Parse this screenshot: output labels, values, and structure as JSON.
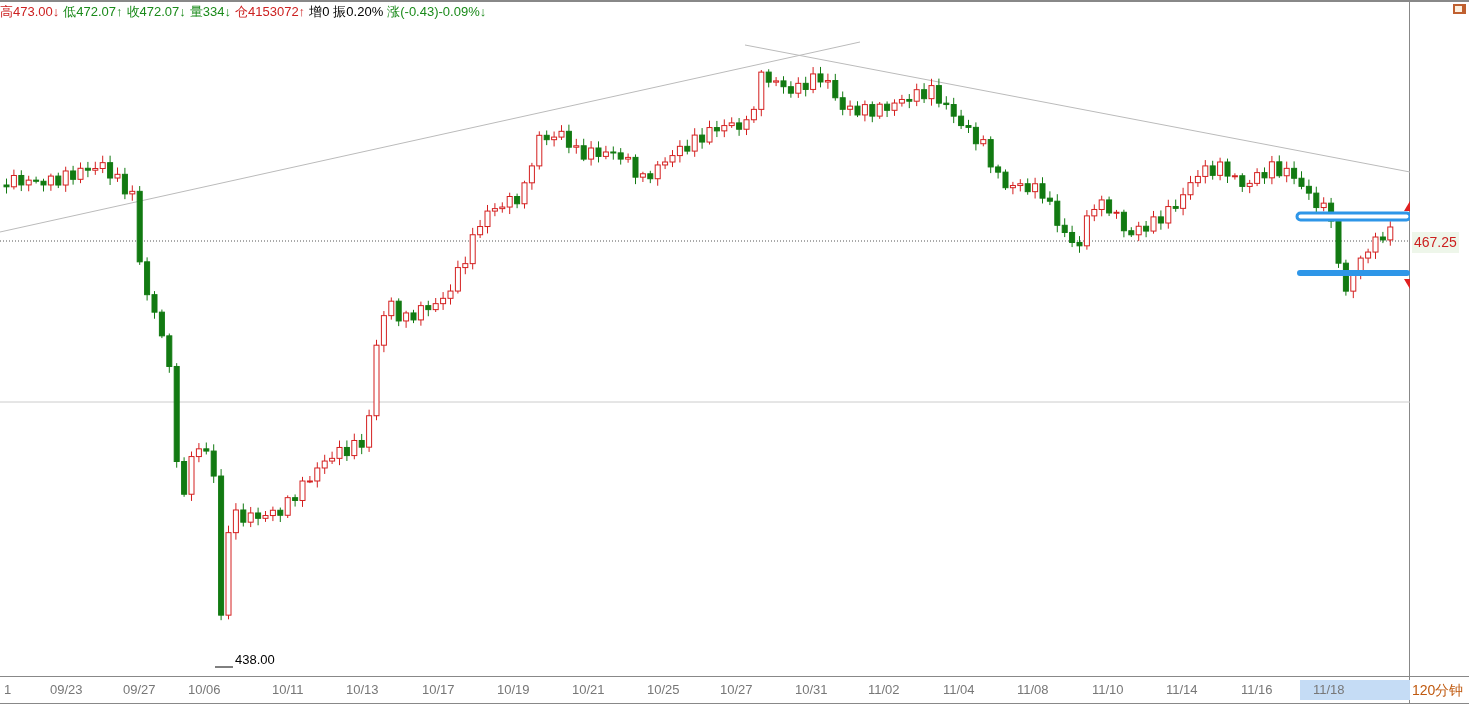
{
  "header": {
    "stats": [
      {
        "text": "高473.00↓",
        "color": "#cc2020"
      },
      {
        "text": "低472.07↑",
        "color": "#1a8a1a"
      },
      {
        "text": "收472.07↓",
        "color": "#1a8a1a"
      },
      {
        "text": "量334↓",
        "color": "#1a8a1a"
      },
      {
        "text": "仓4153072↑",
        "color": "#cc2020"
      },
      {
        "text": "增0",
        "color": "#000000"
      },
      {
        "text": "振0.20%",
        "color": "#000000"
      },
      {
        "text": "涨(-0.43)-0.09%↓",
        "color": "#1a8a1a"
      }
    ]
  },
  "chart": {
    "price_tag": "467.25",
    "low_label": "438.00"
  },
  "x_axis": {
    "labels": [
      {
        "text": "1",
        "selected": false
      },
      {
        "text": "09/23",
        "selected": false
      },
      {
        "text": "09/27",
        "selected": false
      },
      {
        "text": "10/06",
        "selected": false
      },
      {
        "text": "10/11",
        "selected": false
      },
      {
        "text": "10/13",
        "selected": false
      },
      {
        "text": "10/17",
        "selected": false
      },
      {
        "text": "10/19",
        "selected": false
      },
      {
        "text": "10/21",
        "selected": false
      },
      {
        "text": "10/25",
        "selected": false
      },
      {
        "text": "10/27",
        "selected": false
      },
      {
        "text": "10/31",
        "selected": false
      },
      {
        "text": "11/02",
        "selected": false
      },
      {
        "text": "11/04",
        "selected": false
      },
      {
        "text": "11/08",
        "selected": false
      },
      {
        "text": "11/10",
        "selected": false
      },
      {
        "text": "11/14",
        "selected": false
      },
      {
        "text": "11/16",
        "selected": false
      },
      {
        "text": "11/18",
        "selected": true
      }
    ]
  },
  "period": "120分钟"
}
